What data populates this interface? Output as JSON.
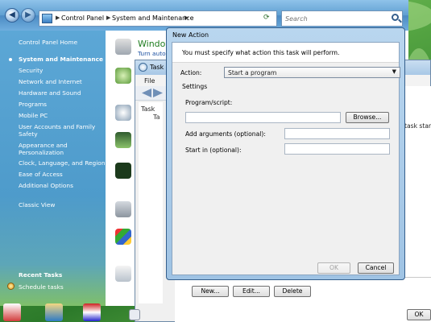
{
  "control_panel": {
    "breadcrumb": [
      "Control Panel",
      "System and Maintenance"
    ],
    "search_placeholder": "Search",
    "sidebar": {
      "home": "Control Panel Home",
      "items": [
        "System and Maintenance",
        "Security",
        "Network and Internet",
        "Hardware and Sound",
        "Programs",
        "Mobile PC",
        "User Accounts and Family Safety",
        "Appearance and Personalization",
        "Clock, Language, and Region",
        "Ease of Access",
        "Additional Options"
      ],
      "classic_view": "Classic View",
      "recent_tasks_title": "Recent Tasks",
      "recent_tasks": [
        "Schedule tasks"
      ]
    },
    "main": {
      "section_title": "Window",
      "section_sub": "Turn autom"
    }
  },
  "task_scheduler": {
    "title": "Task S",
    "menu": [
      "File"
    ],
    "tree": [
      "Task",
      "Ta"
    ],
    "right_text": "task starts",
    "buttons": {
      "new": "New...",
      "edit": "Edit...",
      "delete": "Delete",
      "ok": "OK"
    }
  },
  "new_action_dialog": {
    "title": "New Action",
    "instruction": "You must specify what action this task will perform.",
    "action_label": "Action:",
    "action_value": "Start a program",
    "settings_label": "Settings",
    "program_label": "Program/script:",
    "program_value": "",
    "browse_button": "Browse...",
    "args_label": "Add arguments (optional):",
    "args_value": "",
    "startin_label": "Start in (optional):",
    "startin_value": "",
    "ok_button": "OK",
    "cancel_button": "Cancel"
  },
  "colors": {
    "sidebar": "#4e9bcb",
    "dialog_frame": "#b9d6ef",
    "title_green": "#1f7d1f"
  }
}
